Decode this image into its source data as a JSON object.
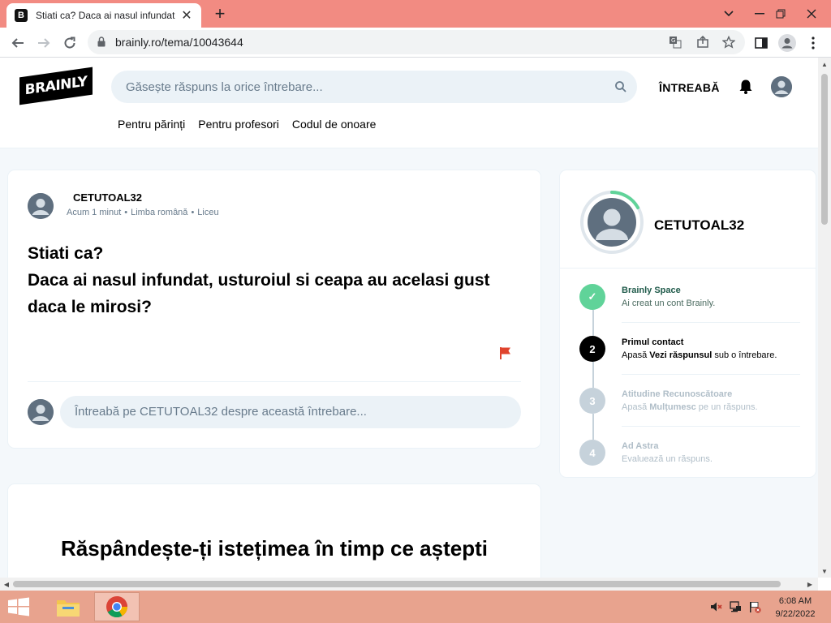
{
  "browser": {
    "tab_favicon": "B",
    "tab_title": "Stiati ca? Daca ai nasul infundat, ",
    "tab_close": "✕",
    "new_tab": "+",
    "url": "brainly.ro/tema/10043644"
  },
  "site": {
    "logo": "BRAINLY",
    "search_placeholder": "Găsește răspuns la orice întrebare...",
    "ask_label": "ÎNTREABĂ",
    "subnav": [
      "Pentru părinți",
      "Pentru profesori",
      "Codul de onoare"
    ]
  },
  "question": {
    "author": "CETUTOAL32",
    "time": "Acum 1 minut",
    "language": "Limba română",
    "level": "Liceu",
    "text_line1": "Stiati ca?",
    "text_line2": "Daca ai nasul infundat, usturoiul si ceapa au acelasi gust daca le mirosi?",
    "comment_placeholder": "Întreabă pe CETUTOAL32 despre această întrebare..."
  },
  "answer_prompt": {
    "title": "Răspândește-ți istețimea în timp ce aștepti"
  },
  "sidebar": {
    "username": "CETUTOAL32",
    "steps": [
      {
        "number": "✓",
        "title": "Brainly Space",
        "desc_pre": "Ai creat un cont Brainly.",
        "desc_bold": "",
        "desc_post": "",
        "state": "done"
      },
      {
        "number": "2",
        "title": "Primul contact",
        "desc_pre": "Apasă ",
        "desc_bold": "Vezi răspunsul",
        "desc_post": " sub o întrebare.",
        "state": "current"
      },
      {
        "number": "3",
        "title": "Atitudine Recunoscătoare",
        "desc_pre": "Apasă ",
        "desc_bold": "Mulțumesc",
        "desc_post": " pe un răspuns.",
        "state": "locked"
      },
      {
        "number": "4",
        "title": "Ad Astra",
        "desc_pre": "Evaluează un răspuns.",
        "desc_bold": "",
        "desc_post": "",
        "state": "locked"
      }
    ]
  },
  "taskbar": {
    "time": "6:08 AM",
    "date": "9/22/2022"
  },
  "colors": {
    "tabstrip": "#f28b82",
    "taskbar": "#e8a38e",
    "step_done": "#60d399",
    "step_current": "#000000",
    "step_locked": "#c6d2db",
    "flag": "#e0442d"
  }
}
